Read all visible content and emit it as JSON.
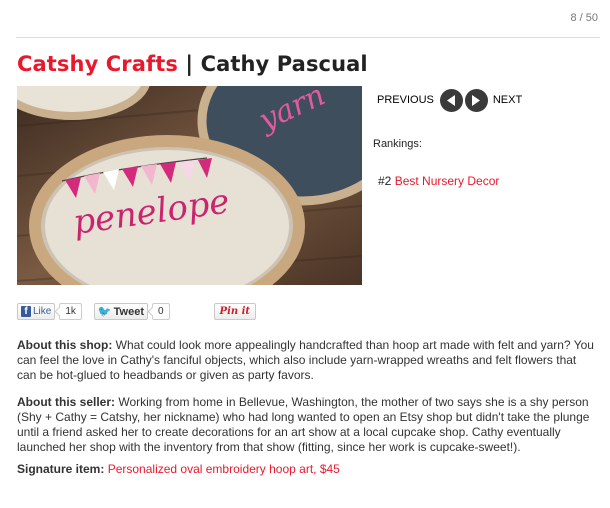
{
  "counter": "8 / 50",
  "title": {
    "shop": "Catshy Crafts",
    "separator": " | ",
    "person": "Cathy Pascual"
  },
  "photo": {
    "labels": [
      "penelope",
      "yarn"
    ]
  },
  "nav": {
    "previous": "PREVIOUS",
    "next": "NEXT"
  },
  "rankings": {
    "label": "Rankings:",
    "items": [
      {
        "rank": "#2",
        "name": "Best Nursery Decor"
      }
    ]
  },
  "share": {
    "facebook_label": "Like",
    "facebook_count": "1k",
    "twitter_label": "Tweet",
    "twitter_count": "0",
    "pinterest_label": "Pin it"
  },
  "about_shop": {
    "heading": "About this shop:",
    "text": " What could look more appealingly handcrafted than hoop art made with felt and yarn? You can feel the love in Cathy's fanciful objects, which also include yarn-wrapped wreaths and felt flowers that can be hot-glued to headbands or given as party favors."
  },
  "about_seller": {
    "heading": "About this seller:",
    "text": " Working from home in Bellevue, Washington, the mother of two says she is a shy person (Shy + Cathy = Catshy, her nickname) who had long wanted to open an Etsy shop but didn't take the plunge until a friend asked her to create decorations for an art show at a local cupcake shop. Cathy eventually launched her shop with the inventory from that show (fitting, since her work is cupcake-sweet!)."
  },
  "signature": {
    "heading": "Signature item:",
    "link": "Personalized oval embroidery hoop art, $45"
  },
  "colors": {
    "accent": "#e8192c",
    "text": "#333333",
    "nav_button": "#3a3a3a"
  }
}
